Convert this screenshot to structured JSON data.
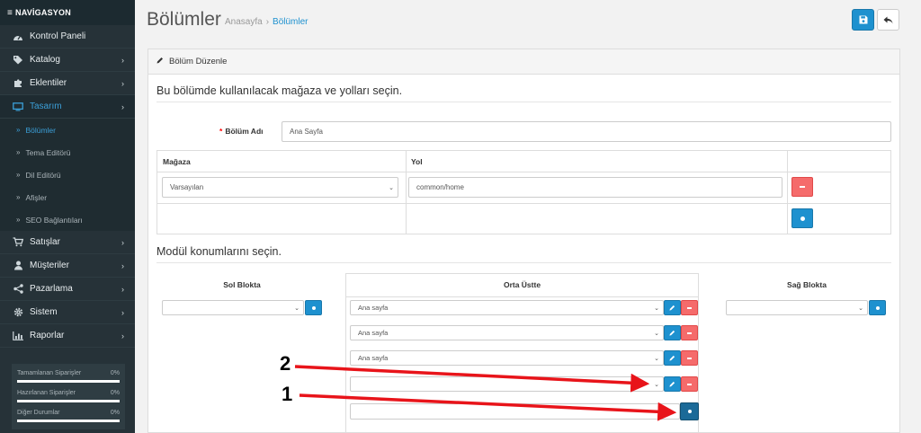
{
  "sidebar": {
    "nav_title": "NAVİGASYON",
    "items": [
      {
        "label": "Kontrol Paneli",
        "icon": "dashboard-icon"
      },
      {
        "label": "Katalog",
        "icon": "tags-icon"
      },
      {
        "label": "Eklentiler",
        "icon": "puzzle-icon"
      },
      {
        "label": "Tasarım",
        "icon": "monitor-icon"
      },
      {
        "label": "Satışlar",
        "icon": "cart-icon"
      },
      {
        "label": "Müşteriler",
        "icon": "user-icon"
      },
      {
        "label": "Pazarlama",
        "icon": "share-icon"
      },
      {
        "label": "Sistem",
        "icon": "gear-icon"
      },
      {
        "label": "Raporlar",
        "icon": "bar-chart-icon"
      }
    ],
    "submenu": [
      "Bölümler",
      "Tema Editörü",
      "Dil Editörü",
      "Afişler",
      "SEO Bağlantıları"
    ],
    "stats": [
      {
        "label": "Tamamlanan Siparişler",
        "percent": "0%"
      },
      {
        "label": "Hazırlanan Siparişler",
        "percent": "0%"
      },
      {
        "label": "Diğer Durumlar",
        "percent": "0%"
      }
    ]
  },
  "header": {
    "title": "Bölümler",
    "breadcrumb": [
      "Anasayfa",
      "Bölümler"
    ],
    "breadcrumb_sep": "›"
  },
  "panel": {
    "heading": "Bölüm Düzenle",
    "legend_routes": "Bu bölümde kullanılacak mağaza ve yolları seçin.",
    "name_label": "Bölüm Adı",
    "name_value": "Ana Sayfa",
    "col_store": "Mağaza",
    "col_route": "Yol",
    "store_value": "Varsayılan",
    "route_value": "common/home",
    "legend_modules": "Modül konumlarını seçin.",
    "left_title": "Sol Blokta",
    "center_title": "Orta Üstte",
    "right_title": "Sağ Blokta",
    "center_modules": [
      "Ana sayfa",
      "Ana sayfa",
      "Ana sayfa",
      ""
    ]
  },
  "annotations": {
    "label_1": "1",
    "label_2": "2",
    "color": "#e8141a"
  }
}
